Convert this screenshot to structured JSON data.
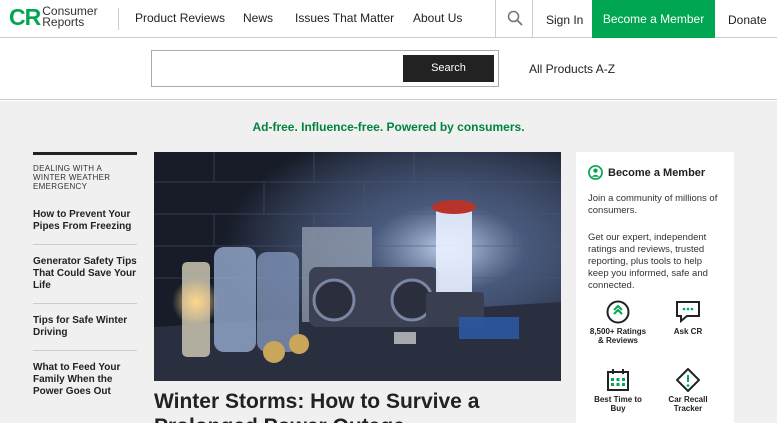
{
  "header": {
    "logo": {
      "mark": "CR",
      "line1": "Consumer",
      "line2": "Reports"
    },
    "nav": [
      "Product Reviews",
      "News",
      "Issues That Matter",
      "About Us"
    ],
    "sign_in": "Sign In",
    "become_member": "Become a Member",
    "donate": "Donate"
  },
  "search": {
    "value": "",
    "button": "Search",
    "all_products": "All Products A-Z"
  },
  "tagline": "Ad-free. Influence-free. Powered by consumers.",
  "sidebar": {
    "heading": "DEALING WITH A WINTER WEATHER EMERGENCY",
    "items": [
      "How to Prevent Your Pipes From Freezing",
      "Generator Safety Tips That Could Save Your Life",
      "Tips for Safe Winter Driving",
      "What to Feed Your Family When the Power Goes Out"
    ]
  },
  "article": {
    "title": "Winter Storms: How to Survive a Prolonged Power Outage"
  },
  "member_card": {
    "title": "Become a Member",
    "para1": "Join a community of millions of consumers.",
    "para2": "Get our expert, independent ratings and reviews, trusted reporting, plus tools to help keep you informed, safe and connected.",
    "features": [
      {
        "label": "8,500+ Ratings & Reviews",
        "icon": "ratings-icon"
      },
      {
        "label": "Ask CR",
        "icon": "chat-icon"
      },
      {
        "label": "Best Time to Buy",
        "icon": "calendar-icon"
      },
      {
        "label": "Car Recall Tracker",
        "icon": "warning-icon"
      }
    ]
  },
  "colors": {
    "brand": "#00a651",
    "tagline": "#00843d"
  }
}
